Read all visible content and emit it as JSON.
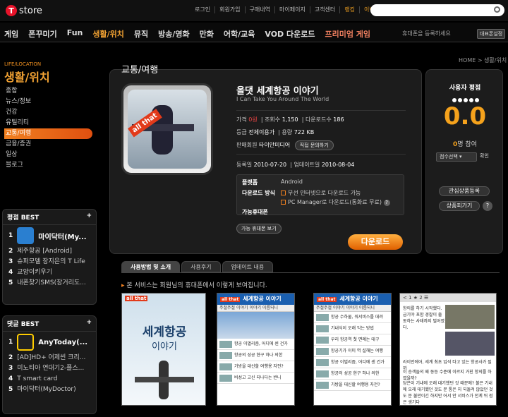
{
  "topbar": {
    "logo_t": "T",
    "logo_text": "store",
    "links": [
      "로그인",
      "회원가입",
      "구매내역",
      "마이페이지",
      "고객센터",
      "랭킹",
      "이벤트"
    ],
    "highlight_links": [
      "랭킹",
      "이벤트"
    ]
  },
  "nav": {
    "items": [
      "게임",
      "폰꾸미기",
      "Fun",
      "생활/위치",
      "뮤직",
      "방송/영화",
      "만화",
      "어학/교육",
      "VOD 다운로드",
      "프리미엄 게임"
    ],
    "active": "생활/위치",
    "phone_text": "휴대폰을 등록하세요",
    "phone_button": "대표폰설정"
  },
  "sidebar": {
    "category_en": "LIFE/LOCATION",
    "category": "생활/위치",
    "menu": [
      "종합",
      "뉴스/정보",
      "건강",
      "유틸리티",
      "교통/여행",
      "금융/증권",
      "일상",
      "블로그"
    ],
    "selected": "교통/여행"
  },
  "best_rating": {
    "title": "평점 BEST",
    "top": {
      "rank": "1",
      "name": "마이닥터(My..."
    },
    "items": [
      {
        "rank": "2",
        "name": "제주항공 [Android]"
      },
      {
        "rank": "3",
        "name": "슈퍼모델 장지은의 T Life"
      },
      {
        "rank": "4",
        "name": "교양이키우기"
      },
      {
        "rank": "5",
        "name": "내폰찾기SMS(장거리도..."
      }
    ]
  },
  "best_comment": {
    "title": "댓글 BEST",
    "top": {
      "rank": "1",
      "name": "AnyToday(..."
    },
    "items": [
      {
        "rank": "2",
        "name": "[AD]HD+ 어제씬 크리..."
      },
      {
        "rank": "3",
        "name": "미노티아 연대기2-플스..."
      },
      {
        "rank": "4",
        "name": "T smart card"
      },
      {
        "rank": "5",
        "name": "마이닥터(MyDoctor)"
      }
    ]
  },
  "breadcrumb": "HOME > 생활/위치",
  "section_title": "교통/여행",
  "app": {
    "icon_tag": "all that",
    "name": "올댓 세계항공 이야기",
    "subtitle": "I Can Take You Around The World",
    "price_label": "가격",
    "price": "0원",
    "views_label": "조회수",
    "views": "1,150",
    "downloads_label": "다운로드수",
    "downloads": "186",
    "grade_label": "등급",
    "grade": "전체이용가",
    "size_label": "용량",
    "size": "722 KB",
    "seller_label": "판매회원",
    "seller": "타이안미디어",
    "contact_button": "직접 문의하기",
    "reg_label": "등록일",
    "reg_date": "2010-07-20",
    "update_label": "업데이트일",
    "update_date": "2010-08-04",
    "platform_label": "플랫폼",
    "platform": "Android",
    "dl_method_label": "다운로드 방식",
    "dl_method_1": "무선 인터넷으로 다운로드 가능",
    "dl_method_2": "PC Manager로 다운로드(통화료 무료)",
    "phone_label": "가능휴대폰",
    "phone_button": "가능 휴대폰 보기",
    "download_button": "다운로드"
  },
  "rating": {
    "title": "사용자 평점",
    "score": "0.0",
    "count": "0",
    "count_suffix": "명 참여",
    "select_label": "점수선택",
    "confirm": "확인",
    "btn_interest": "관심상품등록",
    "btn_gift": "상품피가기"
  },
  "tabs": [
    "사용방법 및 소개",
    "사용후기",
    "업데이트 내용"
  ],
  "notice": "본 서비스는 회원님의 휴대폰에서 이렇게 보여집니다.",
  "shots": {
    "s1_tag": "all that",
    "s1_title": "세계항공",
    "s1_sub": "이야기",
    "header": "세계항공 이야기",
    "header_tag": "all that",
    "bar2": "주절주절   이야기   이야기   이름되니",
    "s2_rows": [
      "항공 이벌리즘, 어디에 센 건가",
      "항공의 성공 현구 하나 의한",
      "가방을 대신할 여행용 자전?",
      "비성고 고신 되나다는 반니"
    ],
    "s3_rows": [
      "항공 수하물, 워서비스를 데려",
      "기내식이 오래 익는 방법",
      "우리 항공역 첫 면례는 대구",
      "항공기가 이미 역 설해는 여행",
      "항공 이벌리즘, 어디에 센 건가",
      "항공의 성공 현구 하나 의한",
      "가방을 대신할 여행용 자전?"
    ],
    "s4_tb": "< 1 ★ 2 ☰",
    "s4_t1": "항의를 하기 시작했다. 급기야 포함 경찰이 출동하는 사태까지 벌어졌다.",
    "s4_t2": "라이언에어, 세계 최초 입석 타고 있는 항공사가 될까",
    "s4_t3": "이 승객들의 왜 동등 수준에 이르지 거친 항의를 하였을까?",
    "s4_t4": "당은이 기내에 오래 대기했던 것 때문에? 불은 기내에 오래 대기했던 것도 문 통은 지 되돌려 않았던 것도 문 불만이긴 하지만 어서 안 서비스가 전계 뒤 점은 생기다"
  }
}
